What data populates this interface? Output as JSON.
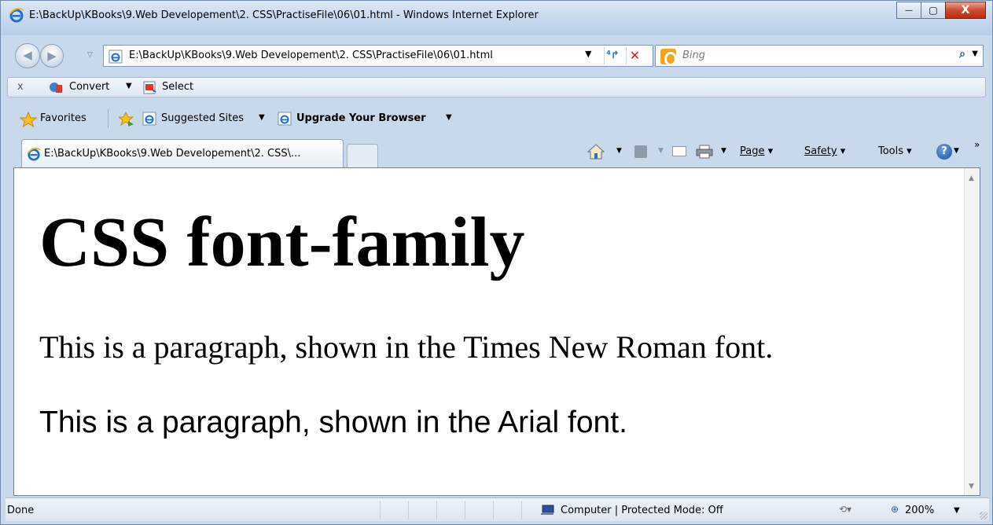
{
  "window": {
    "title": "E:\\BackUp\\KBooks\\9.Web Developement\\2. CSS\\PractiseFile\\06\\01.html - Windows Internet Explorer",
    "controls": {
      "minimize": "—",
      "maximize": "▢",
      "close": "X"
    }
  },
  "nav": {
    "back_glyph": "◀",
    "forward_glyph": "▶",
    "address": "E:\\BackUp\\KBooks\\9.Web Developement\\2. CSS\\PractiseFile\\06\\01.html",
    "refresh_glyph": "⁴↱",
    "stop_glyph": "✕",
    "search_placeholder": "Bing",
    "search_go_glyph": "⌕"
  },
  "commandbar": {
    "close_glyph": "x",
    "convert_label": "Convert",
    "select_label": "Select"
  },
  "favorites": {
    "favorites_label": "Favorites",
    "suggested_label": "Suggested Sites",
    "upgrade_label": "Upgrade Your Browser"
  },
  "tabs": {
    "active_tab_label": "E:\\BackUp\\KBooks\\9.Web Developement\\2. CSS\\..."
  },
  "toolbar": {
    "page_label": "Page",
    "safety_label": "Safety",
    "tools_label": "Tools",
    "help_glyph": "?",
    "more_glyph": "»"
  },
  "page": {
    "heading": "CSS font-family",
    "paragraph_serif": "This is a paragraph, shown in the Times New Roman font.",
    "paragraph_sans": "This is a paragraph, shown in the Arial font."
  },
  "status": {
    "text": "Done",
    "zone": "Computer | Protected Mode: Off",
    "zoom": "200%"
  },
  "colors": {
    "chrome_bg": "#c9d9ec",
    "titlebar": "#c4d7ee",
    "close_button": "#cc4b31",
    "ie_blue": "#2a76c6",
    "bing_orange": "#f2a61d"
  }
}
